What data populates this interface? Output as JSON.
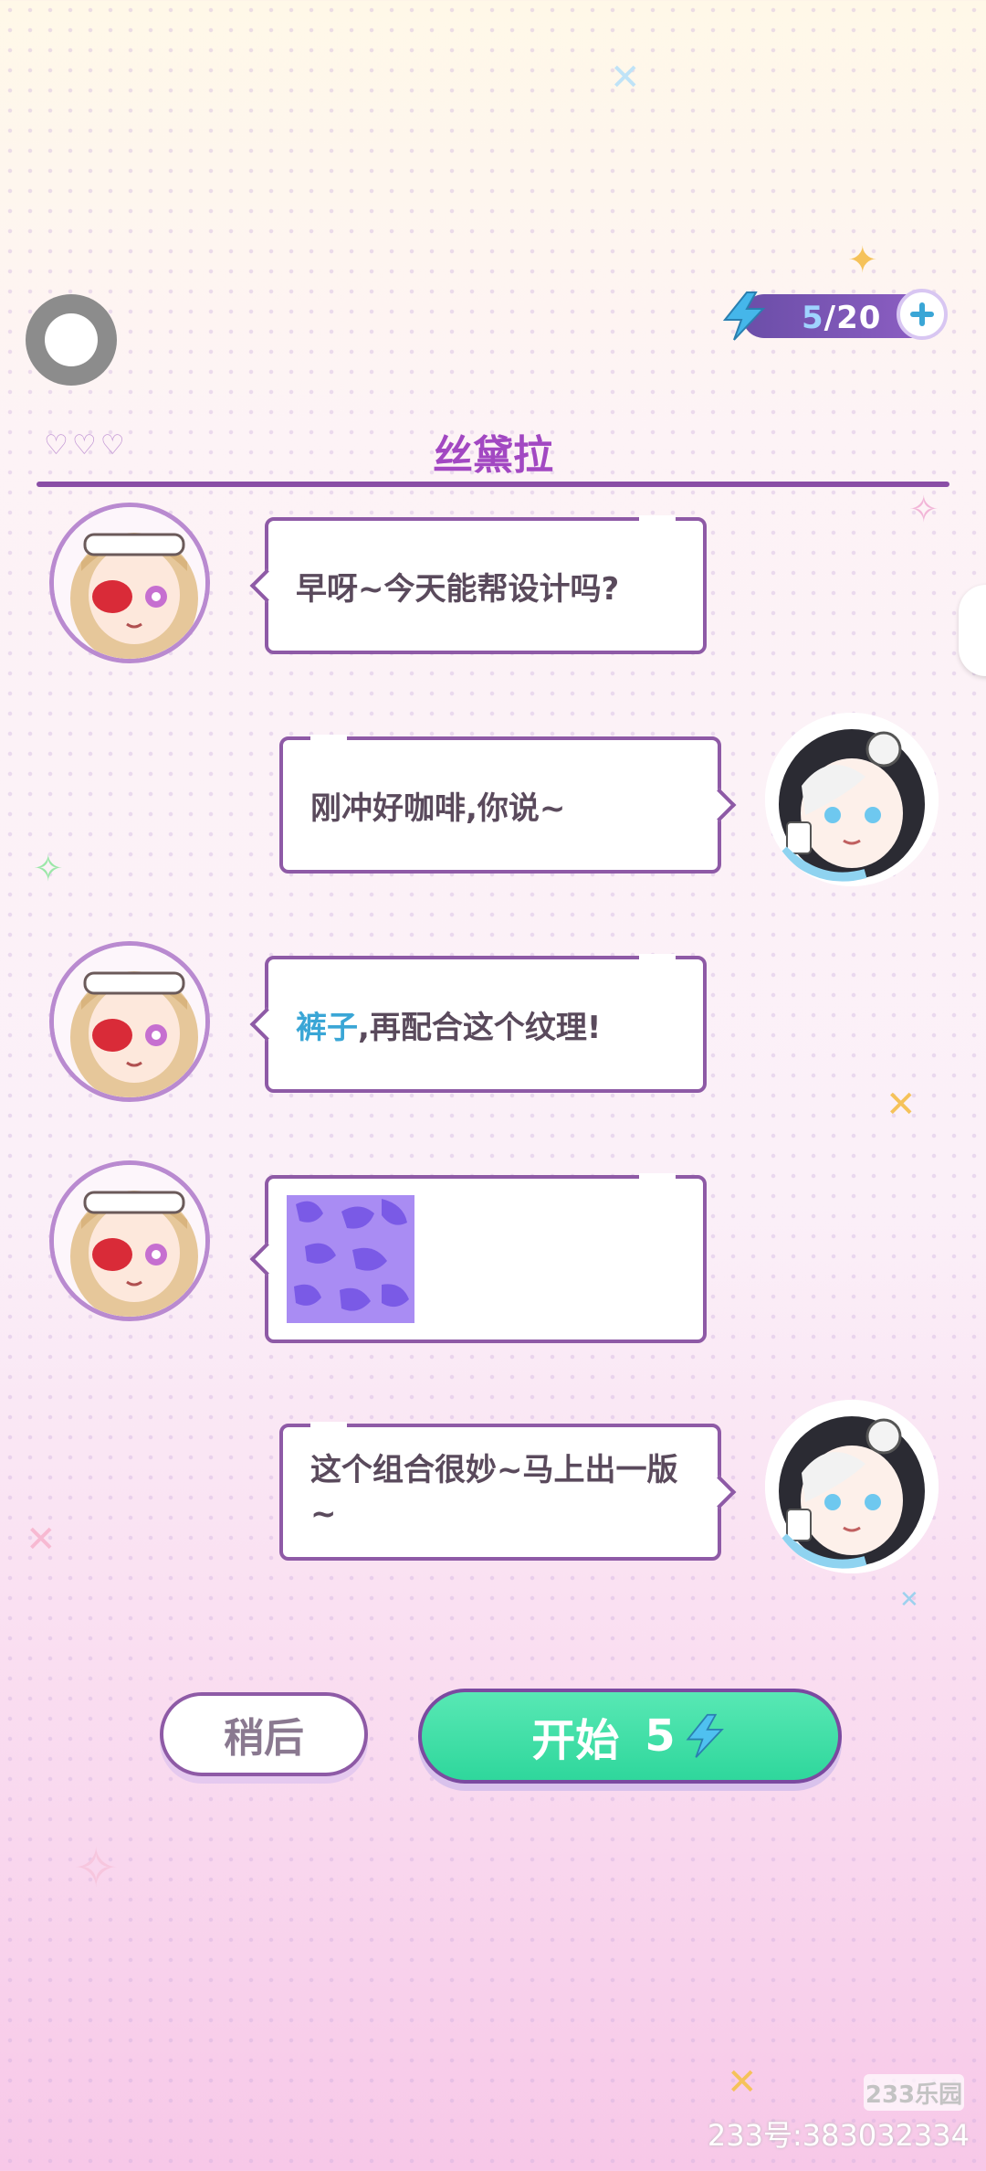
{
  "header": {
    "energy_current": "5",
    "energy_max": "/20"
  },
  "chat": {
    "title": "丝黛拉",
    "messages": [
      {
        "side": "left",
        "text": "早呀~今天能帮设计吗?"
      },
      {
        "side": "right",
        "text": "刚冲好咖啡,你说~"
      },
      {
        "side": "left",
        "highlight": "裤子",
        "text": ",再配合这个纹理!"
      },
      {
        "side": "left",
        "type": "texture"
      },
      {
        "side": "right",
        "text": "这个组合很妙~马上出一版~"
      }
    ]
  },
  "buttons": {
    "later": "稍后",
    "start": "开始",
    "start_cost": "5"
  },
  "watermark": {
    "logo": "233乐园",
    "text": "233号:383032334"
  },
  "colors": {
    "accent": "#a248c2",
    "border": "#8e5aa6",
    "start_green": "#2fd79c",
    "highlight_blue": "#3aa6d6"
  }
}
